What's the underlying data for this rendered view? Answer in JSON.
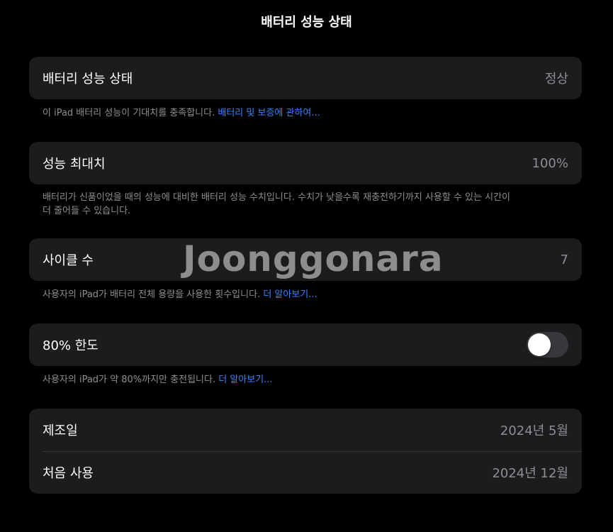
{
  "header": {
    "title": "배터리 성능 상태"
  },
  "health": {
    "label": "배터리 성능 상태",
    "value": "정상",
    "footnote_text": "이 iPad 배터리 성능이 기대치를 충족합니다. ",
    "footnote_link": "배터리 및 보증에 관하여..."
  },
  "max_capacity": {
    "label": "성능 최대치",
    "value": "100%",
    "footnote_line1": "배터리가 신품이었을 때의 성능에 대비한 배터리 성능 수치입니다. 수치가 낮을수록 재충전하기까지 사용할 수 있는 시간이",
    "footnote_line2": "더 줄어들 수 있습니다."
  },
  "cycle_count": {
    "label": "사이클 수",
    "value": "7",
    "footnote_text": "사용자의 iPad가 배터리 전체 용량을 사용한 횟수입니다. ",
    "footnote_link": "더 알아보기..."
  },
  "limit_80": {
    "label": "80% 한도",
    "enabled": false,
    "footnote_text": "사용자의 iPad가 약 80%까지만 충전됩니다. ",
    "footnote_link": "더 알아보기..."
  },
  "dates": {
    "manufactured_label": "제조일",
    "manufactured_value": "2024년 5월",
    "first_use_label": "처음 사용",
    "first_use_value": "2024년 12월"
  },
  "watermark": "Joonggonara",
  "colors": {
    "background": "#000000",
    "group_bg": "#1c1c1e",
    "secondary_text": "#8e8e93",
    "link": "#3b82f6",
    "toggle_off": "#39393d"
  }
}
